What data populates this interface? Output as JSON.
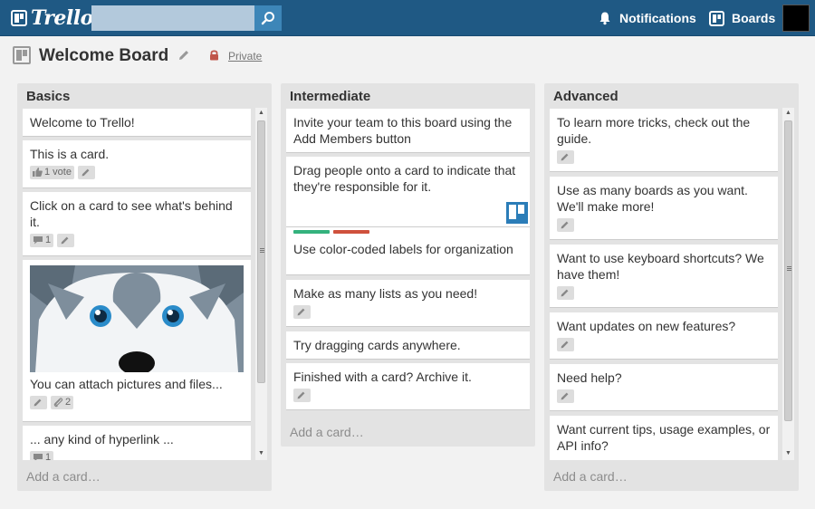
{
  "app": {
    "logo_text": "Trello",
    "search": {
      "value": "",
      "placeholder": ""
    },
    "notifications_label": "Notifications",
    "boards_label": "Boards"
  },
  "board": {
    "title": "Welcome Board",
    "visibility": "Private"
  },
  "colors": {
    "header": "#1f5984",
    "label_green": "#34b27d",
    "label_red": "#cf513d",
    "member": "#2b7db8"
  },
  "lists": [
    {
      "title": "Basics",
      "add_card": "Add a card…",
      "cards": [
        {
          "text": "Welcome to Trello!"
        },
        {
          "text": "This is a card.",
          "vote_label": "1 vote"
        },
        {
          "text": "Click on a card to see what's behind it.",
          "comments": "1"
        },
        {
          "text": "You can attach pictures and files...",
          "attachments": "2",
          "image": "husky-illustration"
        },
        {
          "text": "... any kind of hyperlink ...",
          "comments": "1"
        }
      ]
    },
    {
      "title": "Intermediate",
      "add_card": "Add a card…",
      "cards": [
        {
          "text": "Invite your team to this board using the Add Members button"
        },
        {
          "text": "Drag people onto a card to indicate that they're responsible for it.",
          "member": "trello-member-avatar"
        },
        {
          "text": "Use color-coded labels for organization",
          "labels": [
            "green",
            "red"
          ]
        },
        {
          "text": "Make as many lists as you need!"
        },
        {
          "text": "Try dragging cards anywhere."
        },
        {
          "text": "Finished with a card? Archive it."
        }
      ]
    },
    {
      "title": "Advanced",
      "add_card": "Add a card…",
      "cards": [
        {
          "text": "To learn more tricks, check out the guide."
        },
        {
          "text": "Use as many boards as you want. We'll make more!"
        },
        {
          "text": "Want to use keyboard shortcuts? We have them!"
        },
        {
          "text": "Want updates on new features?"
        },
        {
          "text": "Need help?"
        },
        {
          "text": "Want current tips, usage examples, or API info?"
        }
      ]
    }
  ]
}
